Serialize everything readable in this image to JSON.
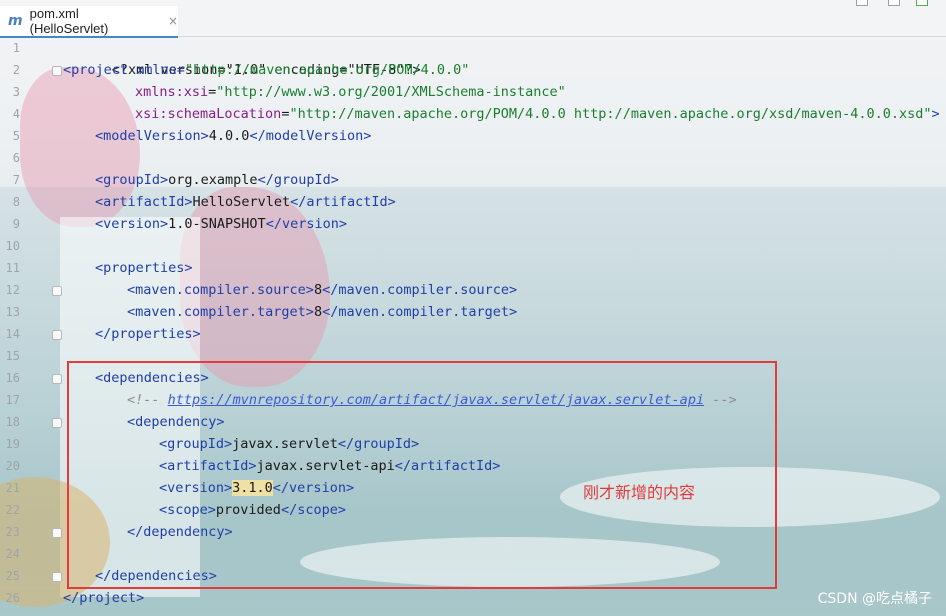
{
  "tab": {
    "icon": "m",
    "label": "pom.xml (HelloServlet)",
    "close": "×"
  },
  "lines": [
    {
      "n": "1"
    },
    {
      "n": "2"
    },
    {
      "n": "3"
    },
    {
      "n": "4"
    },
    {
      "n": "5"
    },
    {
      "n": "6"
    },
    {
      "n": "7"
    },
    {
      "n": "8"
    },
    {
      "n": "9"
    },
    {
      "n": "10"
    },
    {
      "n": "11"
    },
    {
      "n": "12"
    },
    {
      "n": "13"
    },
    {
      "n": "14"
    },
    {
      "n": "15"
    },
    {
      "n": "16"
    },
    {
      "n": "17"
    },
    {
      "n": "18"
    },
    {
      "n": "19"
    },
    {
      "n": "20"
    },
    {
      "n": "21"
    },
    {
      "n": "22"
    },
    {
      "n": "23"
    },
    {
      "n": "24"
    },
    {
      "n": "25"
    },
    {
      "n": "26"
    }
  ],
  "code": {
    "l1": "<?xml version=\"1.0\" encoding=\"UTF-8\"?>",
    "l2_tag": "<project",
    "l2_attr": " xmlns=",
    "l2_val": "\"http://maven.apache.org/POM/4.0.0\"",
    "l3_ns": "xmlns:xsi",
    "l3_val": "\"http://www.w3.org/2001/XMLSchema-instance\"",
    "l4_ns": "xsi:schemaLocation",
    "l4_val": "\"http://maven.apache.org/POM/4.0.0 http://maven.apache.org/xsd/maven-4.0.0.xsd\"",
    "l4_end": ">",
    "l5_open": "<modelVersion>",
    "l5_text": "4.0.0",
    "l5_close": "</modelVersion>",
    "l7_open": "<groupId>",
    "l7_text": "org.example",
    "l7_close": "</groupId>",
    "l8_open": "<artifactId>",
    "l8_text": "HelloServlet",
    "l8_close": "</artifactId>",
    "l9_open": "<version>",
    "l9_text": "1.0-SNAPSHOT",
    "l9_close": "</version>",
    "l11": "<properties>",
    "l12_open": "<maven.compiler.source>",
    "l12_text": "8",
    "l12_close": "</maven.compiler.source>",
    "l13_open": "<maven.compiler.target>",
    "l13_text": "8",
    "l13_close": "</maven.compiler.target>",
    "l14": "</properties>",
    "l16": "<dependencies>",
    "l17_open": "<!-- ",
    "l17_url": "https://mvnrepository.com/artifact/javax.servlet/javax.servlet-api",
    "l17_close": " -->",
    "l18": "<dependency>",
    "l19_open": "<groupId>",
    "l19_text": "javax.servlet",
    "l19_close": "</groupId>",
    "l20_open": "<artifactId>",
    "l20_text": "javax.servlet-api",
    "l20_close": "</artifactId>",
    "l21_open": "<version>",
    "l21_text": "3.1.0",
    "l21_close": "</version>",
    "l22_open": "<scope>",
    "l22_text": "provided",
    "l22_close": "</scope>",
    "l23": "</dependency>",
    "l25": "</dependencies>",
    "l26": "</project>"
  },
  "annotation": "刚才新增的内容",
  "watermark": "CSDN @吃点橘子",
  "colors": {
    "annotation_red": "#e23b3b",
    "tag_blue": "#1f3fa8",
    "attr_value_green": "#1a7f2e",
    "namespace_purple": "#8a1d8a"
  }
}
